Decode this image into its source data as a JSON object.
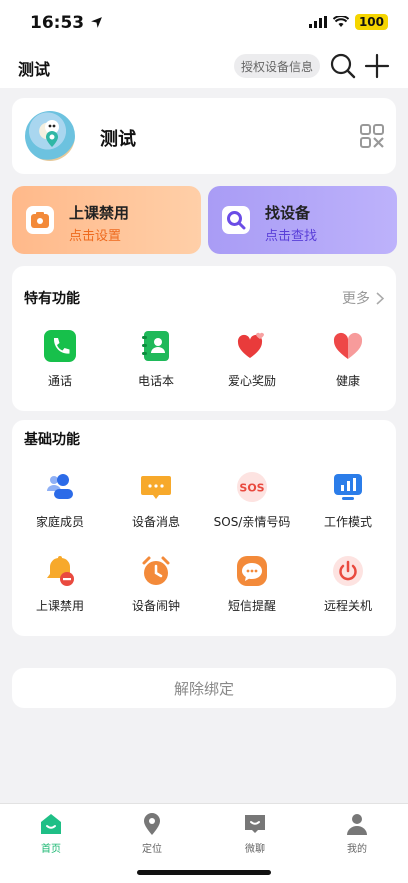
{
  "status_bar": {
    "time": "16:53",
    "battery": "100"
  },
  "topbar": {
    "title": "测试",
    "auth_label": "授权设备信息"
  },
  "profile": {
    "name": "测试"
  },
  "promos": [
    {
      "title": "上课禁用",
      "subtitle": "点击设置"
    },
    {
      "title": "找设备",
      "subtitle": "点击查找"
    }
  ],
  "special": {
    "title": "特有功能",
    "more": "更多",
    "items": [
      {
        "label": "通话",
        "icon": "phone-icon"
      },
      {
        "label": "电话本",
        "icon": "contacts-book-icon"
      },
      {
        "label": "爱心奖励",
        "icon": "heart-reward-icon"
      },
      {
        "label": "健康",
        "icon": "health-heart-icon"
      }
    ]
  },
  "basic": {
    "title": "基础功能",
    "items": [
      {
        "label": "家庭成员",
        "icon": "family-members-icon"
      },
      {
        "label": "设备消息",
        "icon": "message-icon"
      },
      {
        "label": "SOS/亲情号码",
        "icon": "sos-icon"
      },
      {
        "label": "工作模式",
        "icon": "chart-monitor-icon"
      },
      {
        "label": "上课禁用",
        "icon": "bell-disable-icon"
      },
      {
        "label": "设备闹钟",
        "icon": "alarm-clock-icon"
      },
      {
        "label": "短信提醒",
        "icon": "sms-bubble-icon"
      },
      {
        "label": "远程关机",
        "icon": "power-icon"
      }
    ]
  },
  "unbind_label": "解除绑定",
  "tabs": [
    {
      "label": "首页",
      "icon": "home-icon",
      "active": true
    },
    {
      "label": "定位",
      "icon": "location-pin-icon",
      "active": false
    },
    {
      "label": "微聊",
      "icon": "chat-icon",
      "active": false
    },
    {
      "label": "我的",
      "icon": "person-icon",
      "active": false
    }
  ],
  "colors": {
    "accent_green": "#1db873",
    "orange": "#ee6a1e",
    "purple": "#5a3fd8"
  }
}
